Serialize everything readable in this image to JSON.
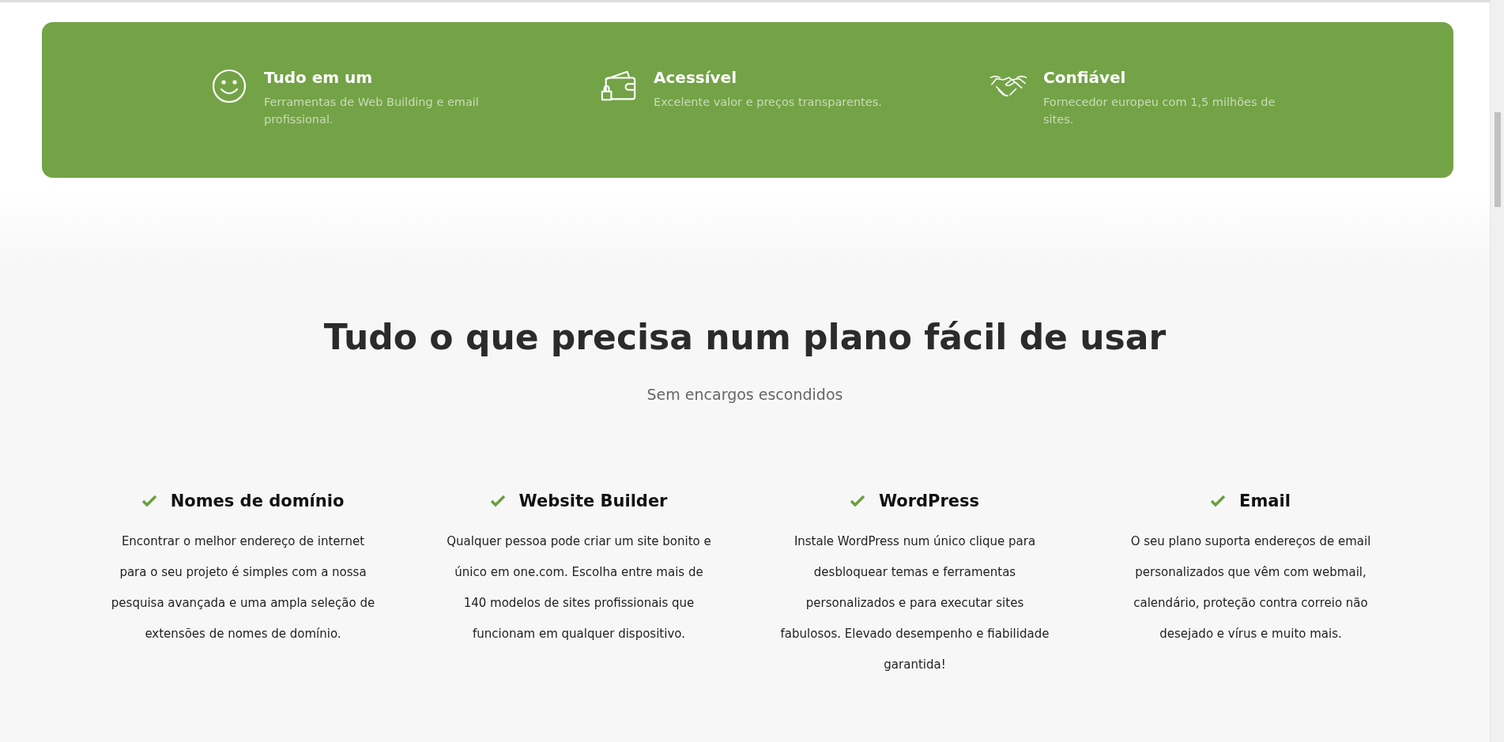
{
  "banner": {
    "items": [
      {
        "title": "Tudo em um",
        "text": "Ferramentas de Web Building e email profissional."
      },
      {
        "title": "Acessível",
        "text": "Excelente valor e preços transparentes."
      },
      {
        "title": "Confiável",
        "text": "Fornecedor europeu com 1,5 milhões de sites."
      }
    ]
  },
  "section": {
    "heading": "Tudo o que precisa num plano fácil de usar",
    "subtitle": "Sem encargos escondidos",
    "features": [
      {
        "title": "Nomes de domínio",
        "text": "Encontrar o melhor endereço de internet para o seu projeto é simples com a nossa pesquisa avançada e uma ampla seleção de extensões de nomes de domínio."
      },
      {
        "title": "Website Builder",
        "text": "Qualquer pessoa pode criar um site bonito e único em one.com. Escolha entre mais de 140 modelos de sites profissionais que funcionam em qualquer dispositivo."
      },
      {
        "title": "WordPress",
        "text": "Instale WordPress num único clique para desbloquear temas e ferramentas personalizados e para executar sites fabulosos. Elevado desempenho e fiabilidade garantida!"
      },
      {
        "title": "Email",
        "text": "O seu plano suporta endereços de email personalizados que vêm com webmail, calendário, proteção contra correio não desejado e vírus e muito mais."
      }
    ]
  }
}
